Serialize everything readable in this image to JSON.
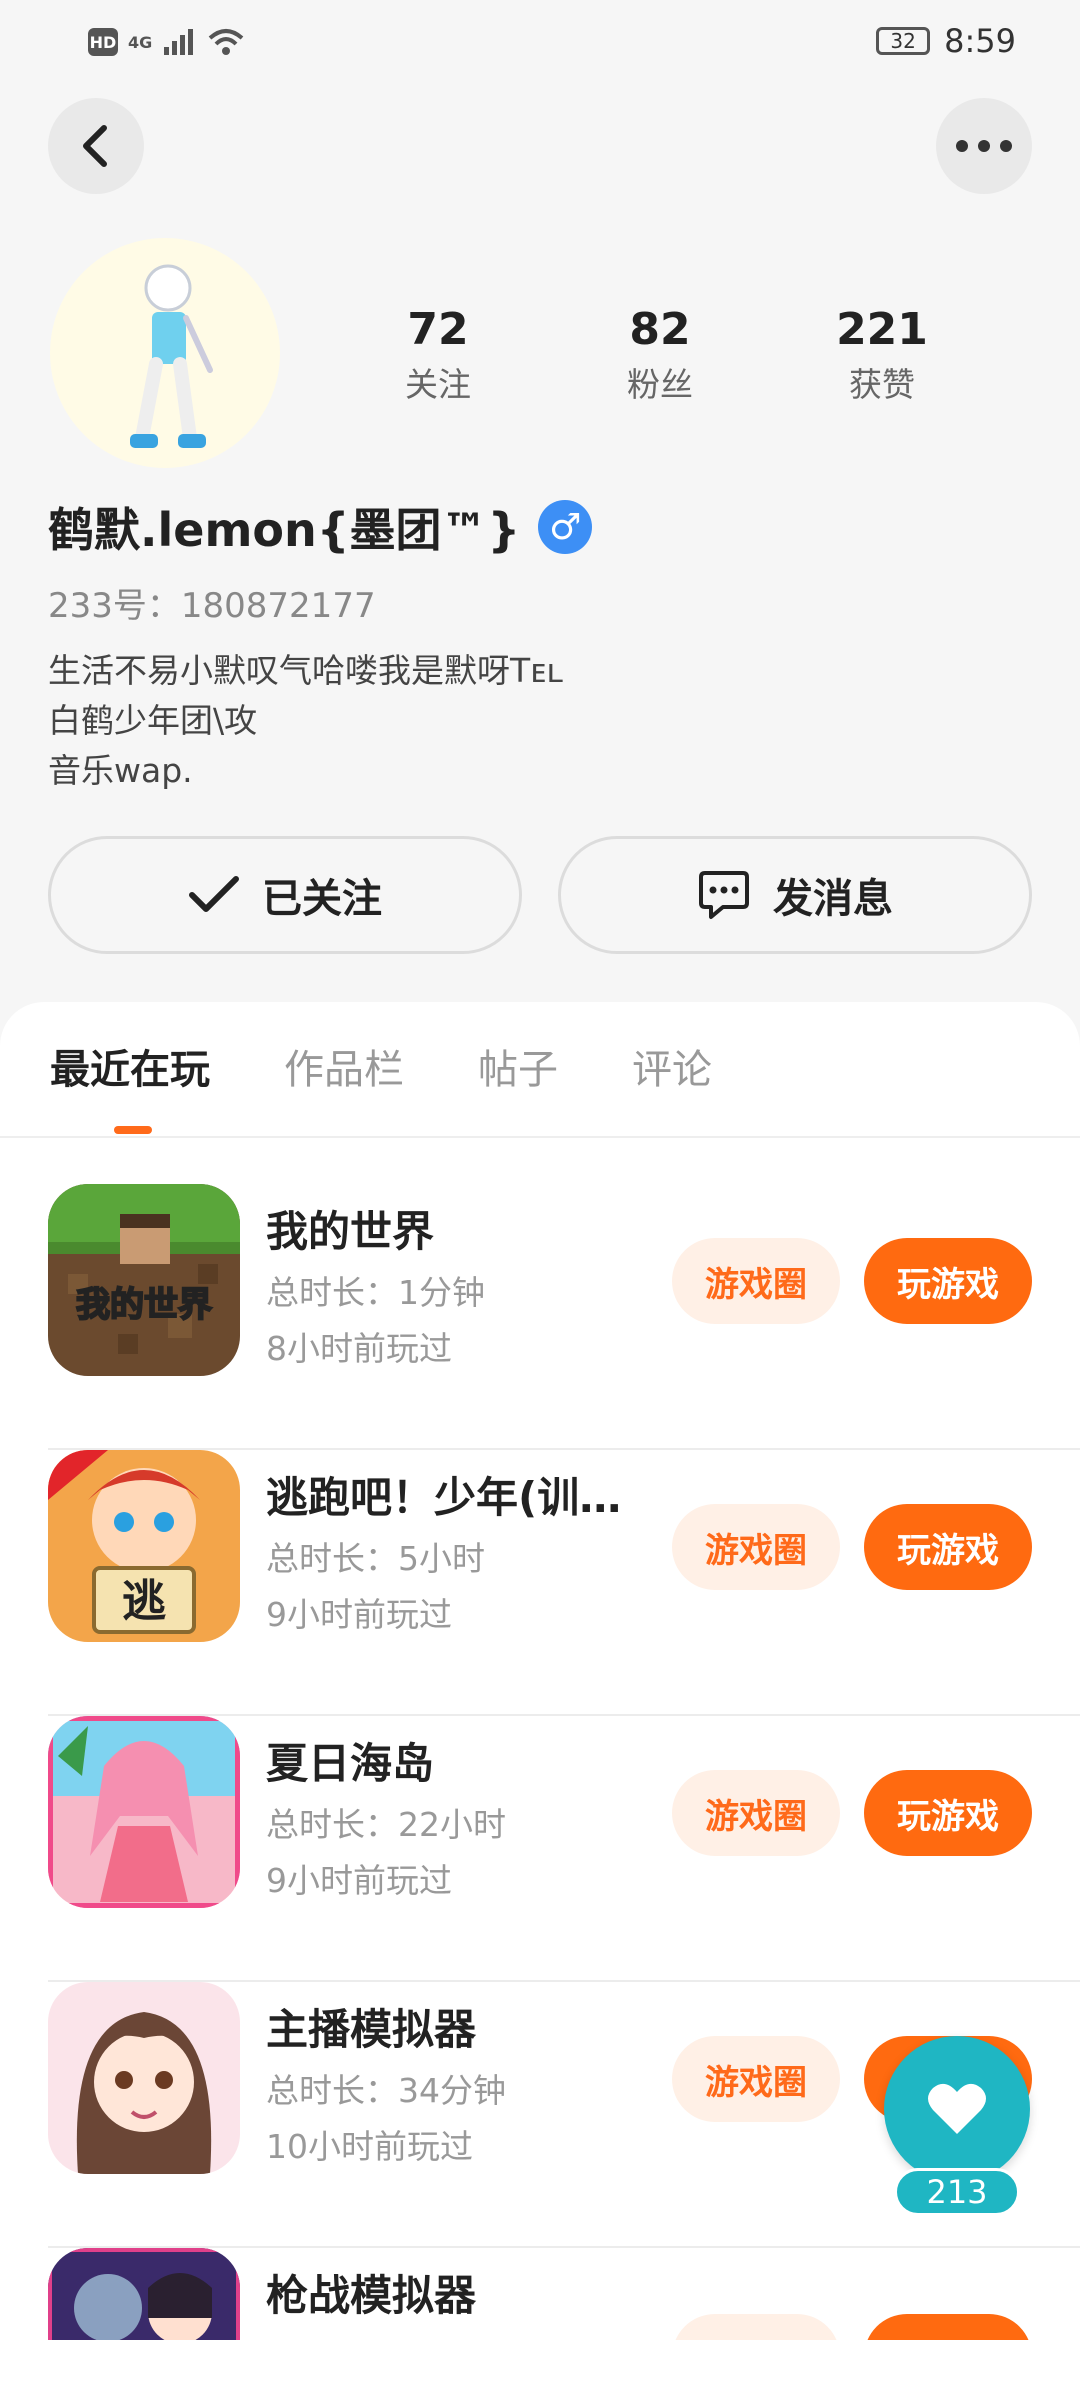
{
  "status_bar": {
    "hd": "HD",
    "network": "4G",
    "battery": "32",
    "time": "8:59"
  },
  "profile": {
    "stats": [
      {
        "value": "72",
        "label": "关注"
      },
      {
        "value": "82",
        "label": "粉丝"
      },
      {
        "value": "221",
        "label": "获赞"
      }
    ],
    "username": "鹤默.lemon{墨团™}",
    "gender_symbol": "♂",
    "uid": "233号：180872177",
    "bio": [
      "生活不易小默叹气哈喽我是默呀Tᴇʟ",
      "白鹤少年团\\攻",
      "音乐wap."
    ]
  },
  "actions": {
    "follow_label": "已关注",
    "message_label": "发消息"
  },
  "tabs": [
    "最近在玩",
    "作品栏",
    "帖子",
    "评论"
  ],
  "game_buttons": {
    "circle": "游戏圈",
    "play": "玩游戏"
  },
  "games": [
    {
      "name": "我的世界",
      "duration": "总时长：1分钟",
      "last_played": "8小时前玩过",
      "icon_text": "我的世界"
    },
    {
      "name": "逃跑吧！少年(训…",
      "duration": "总时长：5小时",
      "last_played": "9小时前玩过",
      "icon_text": "逃"
    },
    {
      "name": "夏日海岛",
      "duration": "总时长：22小时",
      "last_played": "9小时前玩过",
      "icon_text": ""
    },
    {
      "name": "主播模拟器",
      "duration": "总时长：34分钟",
      "last_played": "10小时前玩过",
      "icon_text": ""
    },
    {
      "name": "枪战模拟器",
      "duration": "",
      "last_played": "",
      "icon_text": ""
    }
  ],
  "like_fab": {
    "count": "213"
  }
}
